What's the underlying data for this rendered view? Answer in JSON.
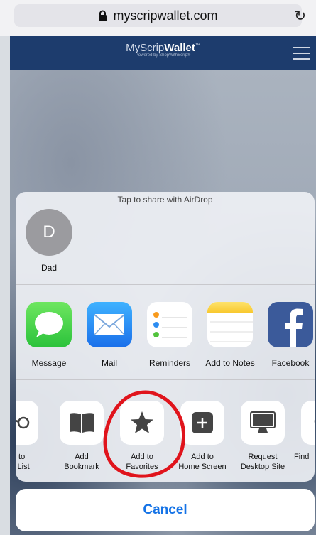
{
  "browser": {
    "url": "myscripwallet.com"
  },
  "site": {
    "brand_light": "MyScrip",
    "brand_bold": "Wallet",
    "brand_tm": "™",
    "tagline": "Powered by ShopWithScrip®"
  },
  "share_sheet": {
    "airdrop_label": "Tap to share with AirDrop",
    "contact": {
      "initial": "D",
      "name": "Dad"
    },
    "apps": [
      {
        "label": "Message"
      },
      {
        "label": "Mail"
      },
      {
        "label": "Reminders"
      },
      {
        "label": "Add to Notes"
      },
      {
        "label": "Facebook"
      }
    ],
    "actions": [
      {
        "label": "dd to\nling List"
      },
      {
        "label": "Add\nBookmark"
      },
      {
        "label": "Add to\nFavorites"
      },
      {
        "label": "Add to\nHome Screen"
      },
      {
        "label": "Request\nDesktop Site"
      },
      {
        "label": "Find"
      }
    ],
    "cancel_label": "Cancel"
  },
  "colors": {
    "accent": "#1573e6",
    "annotation": "#e0141c",
    "site_bar": "#1d3c6d"
  },
  "icons": {
    "reload": "↻",
    "apps": [
      "messages-icon",
      "mail-icon",
      "reminders-icon",
      "notes-icon",
      "facebook-icon"
    ],
    "actions": [
      "glasses-icon",
      "book-icon",
      "star-icon",
      "plus-square-icon",
      "desktop-icon",
      "search-icon"
    ]
  }
}
